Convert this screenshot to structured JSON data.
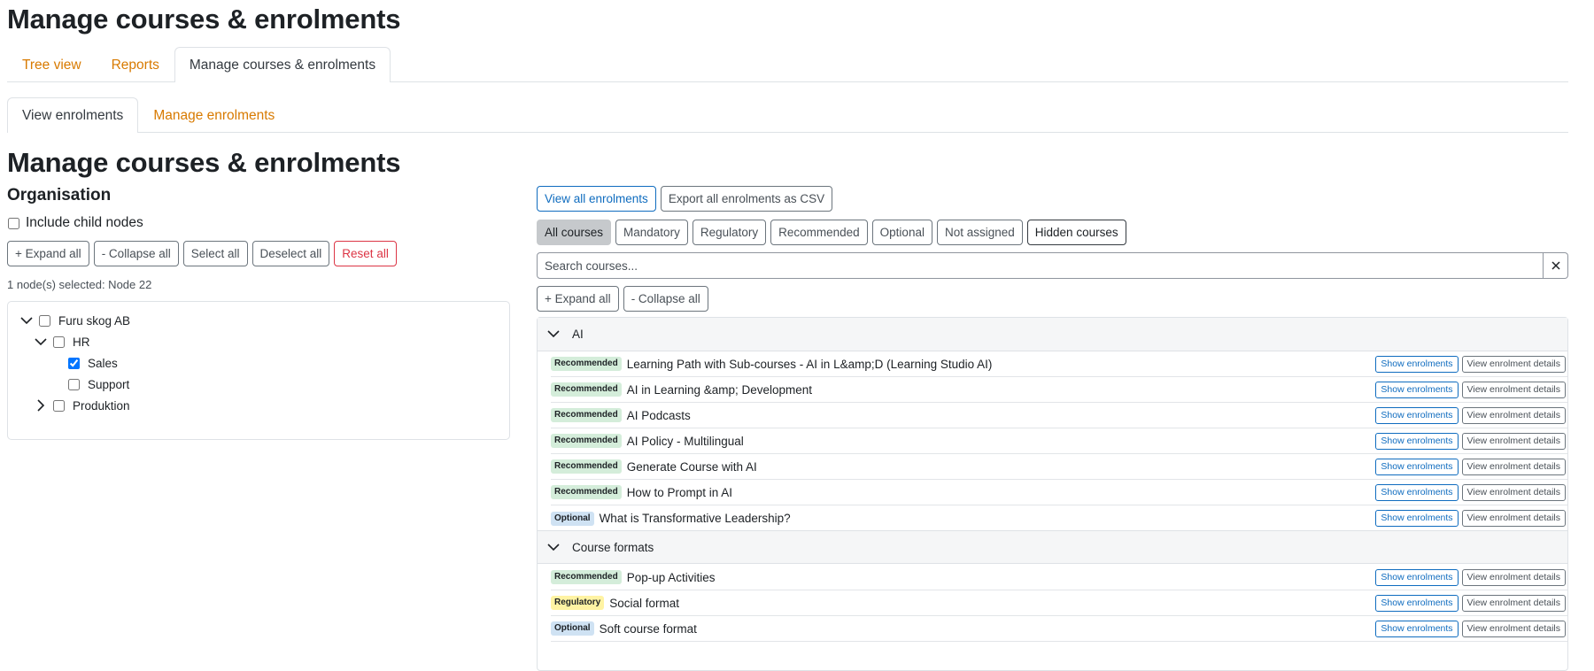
{
  "page_title": "Manage courses & enrolments",
  "top_tabs": [
    {
      "label": "Tree view"
    },
    {
      "label": "Reports"
    },
    {
      "label": "Manage courses & enrolments",
      "active": true
    }
  ],
  "sub_tabs": [
    {
      "label": "View enrolments",
      "active": true
    },
    {
      "label": "Manage enrolments"
    }
  ],
  "section_title": "Manage courses & enrolments",
  "organisation": {
    "heading": "Organisation",
    "include_child_nodes": "Include child nodes",
    "buttons": {
      "expand_all": "+ Expand all",
      "collapse_all": "- Collapse all",
      "select_all": "Select all",
      "deselect_all": "Deselect all",
      "reset_all": "Reset all"
    },
    "selected_info": "1 node(s) selected: Node 22",
    "tree": [
      {
        "label": "Furu skog AB",
        "checked": false,
        "expanded": true
      },
      {
        "label": "HR",
        "checked": false,
        "expanded": true
      },
      {
        "label": "Sales",
        "checked": true
      },
      {
        "label": "Support",
        "checked": false
      },
      {
        "label": "Produktion",
        "checked": false,
        "expanded": false
      }
    ]
  },
  "courses": {
    "view_all_enrolments": "View all enrolments",
    "export_csv": "Export all enrolments as CSV",
    "filters": {
      "all": "All courses",
      "mandatory": "Mandatory",
      "regulatory": "Regulatory",
      "recommended": "Recommended",
      "optional": "Optional",
      "not_assigned": "Not assigned",
      "hidden": "Hidden courses"
    },
    "search_placeholder": "Search courses...",
    "expand_all": "+ Expand all",
    "collapse_all": "- Collapse all",
    "row_buttons": {
      "show": "Show enrolments",
      "details": "View enrolment details"
    },
    "groups": [
      {
        "name": "AI",
        "items": [
          {
            "badge": "Recommended",
            "name": "Learning Path with Sub-courses - AI in L&amp;D (Learning Studio AI)"
          },
          {
            "badge": "Recommended",
            "name": "AI in Learning &amp; Development"
          },
          {
            "badge": "Recommended",
            "name": "AI Podcasts"
          },
          {
            "badge": "Recommended",
            "name": "AI Policy - Multilingual"
          },
          {
            "badge": "Recommended",
            "name": "Generate Course with AI"
          },
          {
            "badge": "Recommended",
            "name": "How to Prompt in AI"
          },
          {
            "badge": "Optional",
            "name": "What is Transformative Leadership?"
          }
        ]
      },
      {
        "name": "Course formats",
        "items": [
          {
            "badge": "Recommended",
            "name": "Pop-up Activities"
          },
          {
            "badge": "Regulatory",
            "name": "Social format"
          },
          {
            "badge": "Optional",
            "name": "Soft course format"
          }
        ]
      }
    ]
  },
  "colors": {
    "link_orange": "#d87a00",
    "primary_blue": "#0f6cbf",
    "danger_red": "#dc3545",
    "badge_recommended": "#d4edda",
    "badge_regulatory": "#fff3a3",
    "badge_optional": "#cfe2f3"
  },
  "icons": {
    "chevron_down": "chevron-down-icon",
    "chevron_right": "chevron-right-icon",
    "clear": "close-icon"
  }
}
